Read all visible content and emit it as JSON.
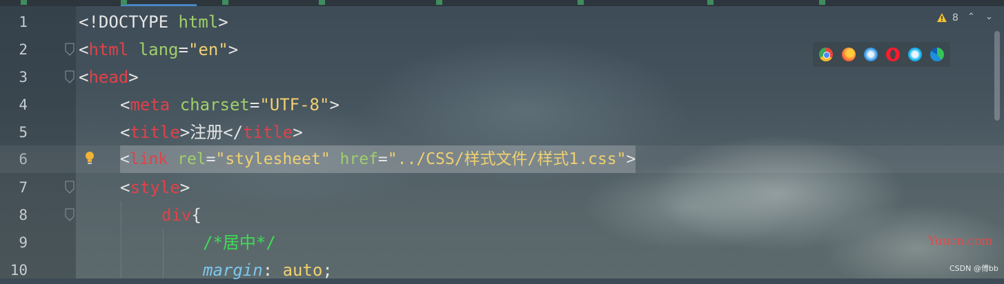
{
  "tabs": [
    {
      "label": ""
    },
    {
      "label": ""
    },
    {
      "label": ""
    },
    {
      "label": ""
    },
    {
      "label": ""
    },
    {
      "label": ""
    },
    {
      "label": ""
    },
    {
      "label": ""
    }
  ],
  "editor": {
    "lines": [
      {
        "num": "1"
      },
      {
        "num": "2"
      },
      {
        "num": "3"
      },
      {
        "num": "4"
      },
      {
        "num": "5"
      },
      {
        "num": "6"
      },
      {
        "num": "7"
      },
      {
        "num": "8"
      },
      {
        "num": "9"
      },
      {
        "num": "10"
      }
    ],
    "tokens": {
      "l1": {
        "a": "<!DOCTYPE ",
        "b": "html",
        "c": ">"
      },
      "l2": {
        "a": "<",
        "b": "html ",
        "c": "lang",
        "d": "=",
        "e": "\"en\"",
        "f": ">"
      },
      "l3": {
        "a": "<",
        "b": "head",
        "c": ">"
      },
      "l4": {
        "a": "<",
        "b": "meta ",
        "c": "charset",
        "d": "=",
        "e": "\"UTF-8\"",
        "f": ">"
      },
      "l5": {
        "a": "<",
        "b": "title",
        "c": ">",
        "d": "注册",
        "e": "</",
        "f": "title",
        "g": ">"
      },
      "l6": {
        "a": "<",
        "b": "link ",
        "c": "rel",
        "d": "=",
        "e": "\"stylesheet\" ",
        "f": "href",
        "g": "=",
        "h": "\"../CSS/样式文件/样式1.css\"",
        "i": ">"
      },
      "l7": {
        "a": "<",
        "b": "style",
        "c": ">"
      },
      "l8": {
        "a": "div",
        "b": "{"
      },
      "l9": {
        "a": "/*居中*/"
      },
      "l10": {
        "a": "margin",
        "b": ": ",
        "c": "auto",
        "d": ";"
      }
    },
    "current_line": 6
  },
  "inspection": {
    "warnings": "8",
    "icon": "warning-triangle-icon"
  },
  "browsers": [
    "chrome-icon",
    "firefox-icon",
    "safari-icon",
    "opera-icon",
    "ie-icon",
    "edge-icon"
  ],
  "watermark": {
    "site": "Yuucn.com",
    "credit": "CSDN @傅bb"
  },
  "colors": {
    "tag": "#e0424a",
    "attr": "#9fcf6a",
    "string": "#f0d070",
    "comment": "#3fdc57",
    "property": "#7cc7ee"
  }
}
